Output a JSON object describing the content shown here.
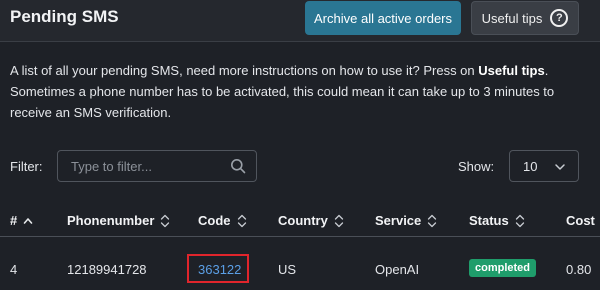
{
  "header": {
    "title": "Pending SMS",
    "archive_label": "Archive all active orders",
    "tips_label": "Useful tips",
    "help_glyph": "?"
  },
  "intro": {
    "line1_prefix": "A list of all your pending SMS, need more instructions on how to use it? Press on ",
    "line1_link": "Useful tips",
    "line1_suffix": ".",
    "line2": "Sometimes a phone number has to be activated, this could mean it can take up to 3 minutes to receive an SMS verification."
  },
  "filter": {
    "label": "Filter:",
    "placeholder": "Type to filter...",
    "icon": "search-icon"
  },
  "show": {
    "label": "Show:",
    "value": "10",
    "icon": "chevron-down-icon"
  },
  "table": {
    "columns": [
      "#",
      "Phonenumber",
      "Code",
      "Country",
      "Service",
      "Status",
      "Cost"
    ],
    "rows": [
      {
        "id": "4",
        "phonenumber": "12189941728",
        "code": "363122",
        "country": "US",
        "service": "OpenAI",
        "status": "completed",
        "cost": "0.80"
      }
    ]
  },
  "colors": {
    "background": "#1e2127",
    "accent": "#2a7693",
    "link": "#5b9fe6",
    "status_completed": "#1f9d6b",
    "highlight_box": "#e0252c"
  }
}
